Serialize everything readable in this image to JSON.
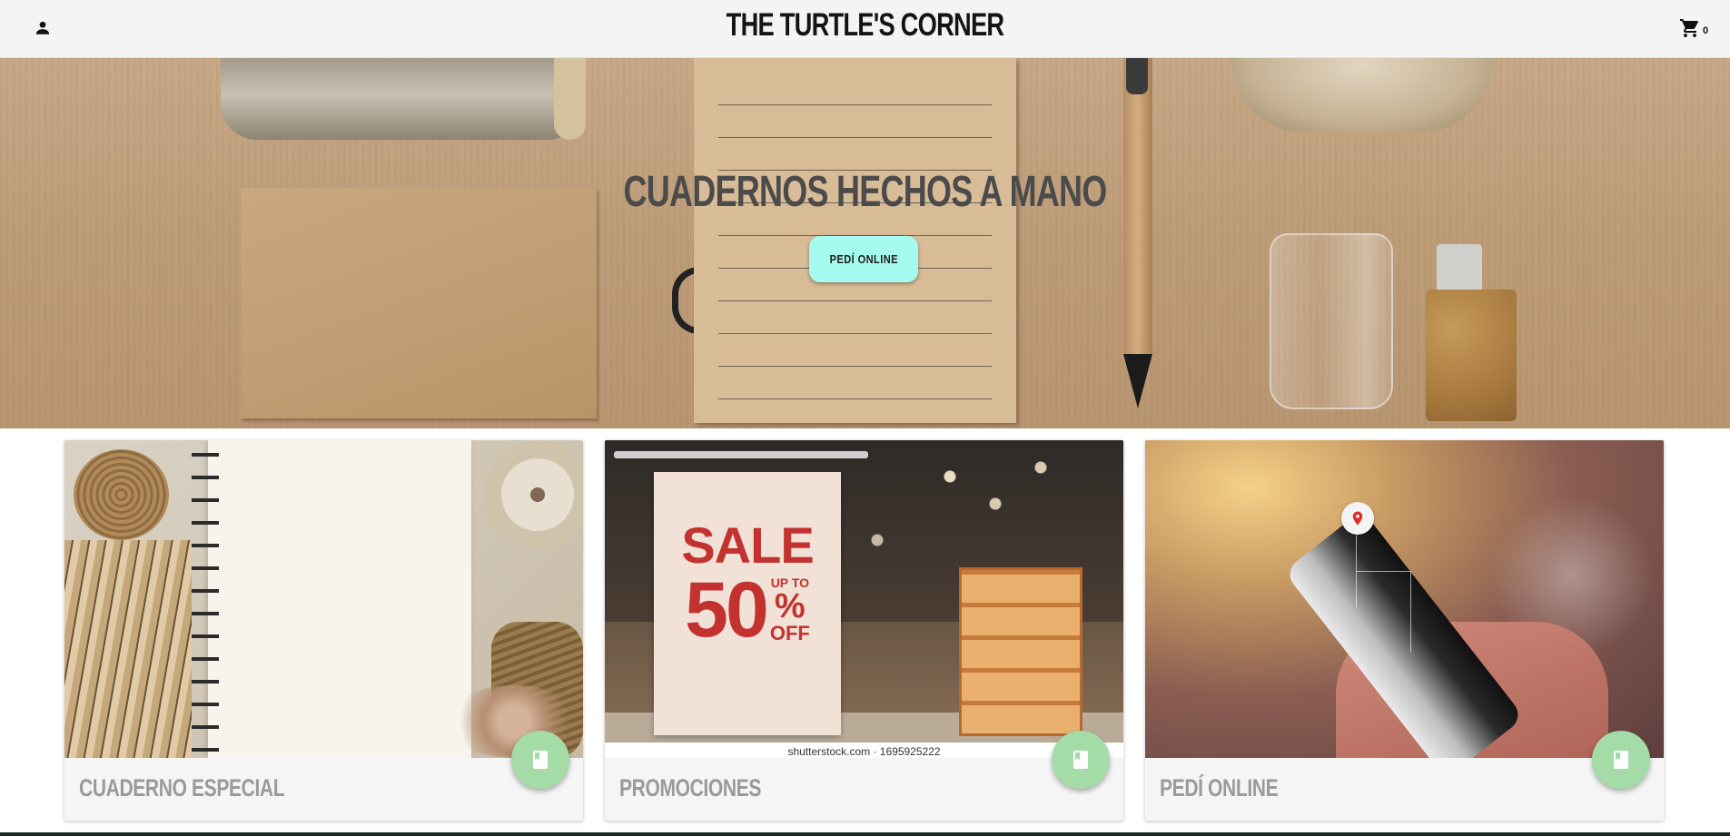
{
  "header": {
    "brand": "THE TURTLE'S CORNER",
    "cart_count": "0"
  },
  "hero": {
    "title": "CUADERNOS HECHOS A MANO",
    "cta_label": "PEDÍ ONLINE"
  },
  "cards": [
    {
      "title": "CUADERNO ESPECIAL"
    },
    {
      "title": "PROMOCIONES",
      "image_text": {
        "sale": "SALE",
        "up_to": "UP TO",
        "amount": "50",
        "percent": "%",
        "off": "OFF",
        "watermark": "shutterstock.com · 1695925222"
      }
    },
    {
      "title": "PEDÍ ONLINE"
    }
  ],
  "colors": {
    "cta": "#a6fbf1",
    "fab": "#a4dba7",
    "header_bg": "#f4f4f4"
  },
  "icons": {
    "user": "person-icon",
    "cart": "shopping-cart-icon",
    "fab": "book-icon",
    "pin": "map-pin-icon"
  }
}
